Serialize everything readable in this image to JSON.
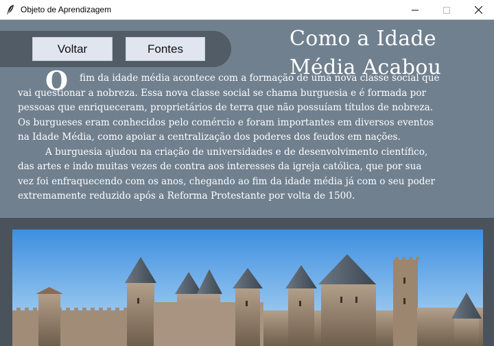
{
  "window": {
    "title": "Objeto de Aprendizagem",
    "icon": "feather-icon",
    "controls": [
      "minimize-icon",
      "maximize-icon",
      "close-icon"
    ]
  },
  "toolbar": {
    "back_label": "Voltar",
    "sources_label": "Fontes"
  },
  "heading": {
    "line1": "Como a Idade",
    "line2": "Média Acabou"
  },
  "article": {
    "dropcap": "O",
    "lines": [
      "fim da idade média acontece com a formação de uma nova classe social que",
      "vai questionar a nobreza. Essa nova classe social se chama burguesia e é formada por",
      "pessoas que enriqueceram, proprietários de terra que não possuíam títulos de nobreza.",
      "Os burgueses eram conhecidos pelo comércio e foram importantes em diversos eventos",
      "na Idade Média, como apoiar a centralização dos poderes dos feudos em nações.",
      "A burguesia ajudou na criação de universidades e de desenvolvimento científico,",
      "das artes e indo muitas vezes de contra aos interesses da igreja católica, que por sua",
      "vez foi enfraquecendo com os anos, chegando ao fim da idade média já com o seu poder",
      "extremamente reduzido após a Reforma Protestante por volta de 1500."
    ]
  },
  "image": {
    "subject": "medieval-castle-photo"
  },
  "colors": {
    "background": "#70808f",
    "toolbar": "#515c66",
    "button": "#e1e5f0",
    "band": "#4a535c",
    "text": "#ffffff"
  }
}
